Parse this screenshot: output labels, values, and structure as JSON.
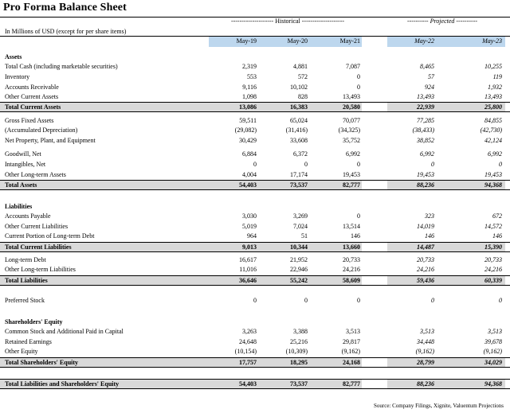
{
  "title": "Pro Forma Balance Sheet",
  "groups": {
    "historical": "-------------------- Historical --------------------",
    "projected": "---------- Projected ----------"
  },
  "units_note": "In Millions of USD (except for per share items)",
  "columns": [
    "May-19",
    "May-20",
    "May-21",
    "May-22",
    "May-23"
  ],
  "rows": [
    {
      "label": "Assets",
      "type": "section"
    },
    {
      "label": "Total Cash (including marketable securities)",
      "values": [
        "2,319",
        "4,881",
        "7,087",
        "8,465",
        "10,255"
      ]
    },
    {
      "label": "Inventory",
      "values": [
        "553",
        "572",
        "0",
        "57",
        "119"
      ]
    },
    {
      "label": "Accounts Receivable",
      "values": [
        "9,116",
        "10,102",
        "0",
        "924",
        "1,932"
      ]
    },
    {
      "label": "Other Current Assets",
      "values": [
        "1,098",
        "828",
        "13,493",
        "13,493",
        "13,493"
      ]
    },
    {
      "label": "Total Current Assets",
      "type": "total",
      "values": [
        "13,086",
        "16,383",
        "20,580",
        "22,939",
        "25,800"
      ]
    },
    {
      "label": "Gross Fixed Assets",
      "values": [
        "59,511",
        "65,024",
        "70,077",
        "77,285",
        "84,855"
      ]
    },
    {
      "label": "(Accumulated Depreciation)",
      "values": [
        "(29,082)",
        "(31,416)",
        "(34,325)",
        "(38,433)",
        "(42,730)"
      ]
    },
    {
      "label": "Net Property, Plant, and Equipment",
      "values": [
        "30,429",
        "33,608",
        "35,752",
        "38,852",
        "42,124"
      ]
    },
    {
      "label": "Goodwill, Net",
      "values": [
        "6,884",
        "6,372",
        "6,992",
        "6,992",
        "6,992"
      ]
    },
    {
      "label": "Intangibles, Net",
      "values": [
        "0",
        "0",
        "0",
        "0",
        "0"
      ]
    },
    {
      "label": "Other Long-term Assets",
      "values": [
        "4,004",
        "17,174",
        "19,453",
        "19,453",
        "19,453"
      ]
    },
    {
      "label": "Total Assets",
      "type": "total",
      "values": [
        "54,403",
        "73,537",
        "82,777",
        "88,236",
        "94,368"
      ]
    },
    {
      "label": "Liabilities",
      "type": "section"
    },
    {
      "label": "Accounts Payable",
      "values": [
        "3,030",
        "3,269",
        "0",
        "323",
        "672"
      ]
    },
    {
      "label": "Other Current Liabilities",
      "values": [
        "5,019",
        "7,024",
        "13,514",
        "14,019",
        "14,572"
      ]
    },
    {
      "label": "Current Portion of Long-term Debt",
      "values": [
        "964",
        "51",
        "146",
        "146",
        "146"
      ]
    },
    {
      "label": "Total Current Liabilities",
      "type": "total",
      "values": [
        "9,013",
        "10,344",
        "13,660",
        "14,487",
        "15,390"
      ]
    },
    {
      "label": "Long-term Debt",
      "values": [
        "16,617",
        "21,952",
        "20,733",
        "20,733",
        "20,733"
      ]
    },
    {
      "label": "Other Long-term Liabilities",
      "values": [
        "11,016",
        "22,946",
        "24,216",
        "24,216",
        "24,216"
      ]
    },
    {
      "label": "Total Liabilities",
      "type": "total",
      "values": [
        "36,646",
        "55,242",
        "58,609",
        "59,436",
        "60,339"
      ]
    },
    {
      "label": "Preferred Stock",
      "values": [
        "0",
        "0",
        "0",
        "0",
        "0"
      ]
    },
    {
      "label": "Shareholders' Equity",
      "type": "section"
    },
    {
      "label": "Common Stock and Additional Paid in Capital",
      "values": [
        "3,263",
        "3,388",
        "3,513",
        "3,513",
        "3,513"
      ]
    },
    {
      "label": "Retained Earnings",
      "values": [
        "24,648",
        "25,216",
        "29,817",
        "34,448",
        "39,678"
      ]
    },
    {
      "label": "Other Equity",
      "values": [
        "(10,154)",
        "(10,309)",
        "(9,162)",
        "(9,162)",
        "(9,162)"
      ]
    },
    {
      "label": "Total Shareholders' Equity",
      "type": "total",
      "values": [
        "17,757",
        "18,295",
        "24,168",
        "28,799",
        "34,029"
      ]
    },
    {
      "label": "Total Liabilities and Shareholders' Equity",
      "type": "total",
      "values": [
        "54,403",
        "73,537",
        "82,777",
        "88,236",
        "94,368"
      ]
    }
  ],
  "source": "Source: Company Filings, Xignite, Valuentum Projections"
}
